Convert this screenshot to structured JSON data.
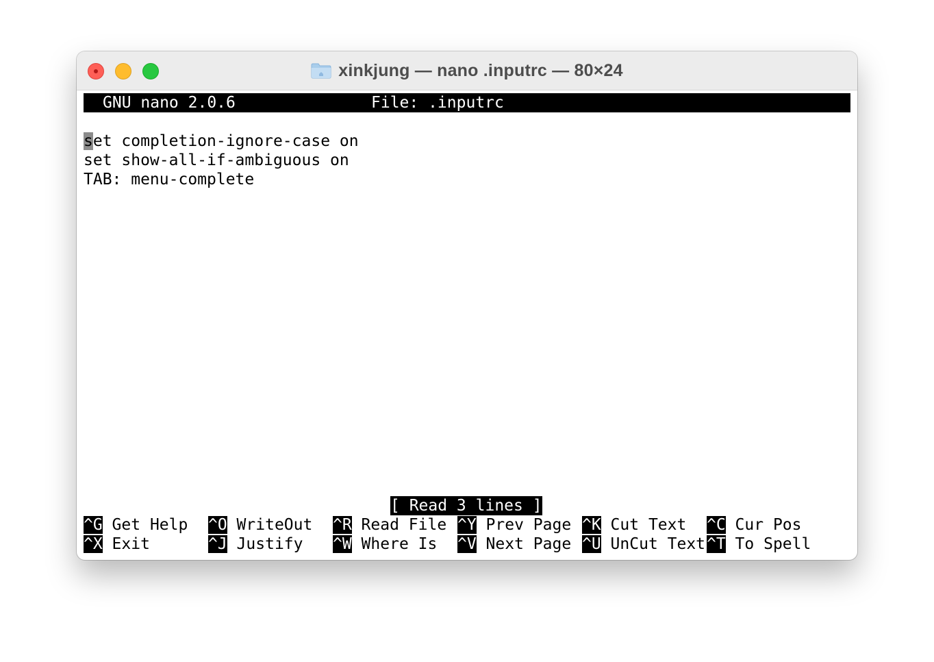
{
  "window": {
    "title": "xinkjung — nano .inputrc — 80×24",
    "icon": "folder-icon"
  },
  "nano": {
    "version_label": "GNU nano 2.0.6",
    "file_label": "File: .inputrc",
    "lines": [
      "set completion-ignore-case on",
      "set show-all-if-ambiguous on",
      "TAB: menu-complete"
    ],
    "cursor_char": "s",
    "first_line_rest": "et completion-ignore-case on",
    "status": "[ Read 3 lines ]"
  },
  "shortcuts": {
    "row1": [
      {
        "key": "^G",
        "label": " Get Help"
      },
      {
        "key": "^O",
        "label": " WriteOut"
      },
      {
        "key": "^R",
        "label": " Read File"
      },
      {
        "key": "^Y",
        "label": " Prev Page"
      },
      {
        "key": "^K",
        "label": " Cut Text"
      },
      {
        "key": "^C",
        "label": " Cur Pos"
      }
    ],
    "row2": [
      {
        "key": "^X",
        "label": " Exit"
      },
      {
        "key": "^J",
        "label": " Justify"
      },
      {
        "key": "^W",
        "label": " Where Is"
      },
      {
        "key": "^V",
        "label": " Next Page"
      },
      {
        "key": "^U",
        "label": " UnCut Text"
      },
      {
        "key": "^T",
        "label": " To Spell"
      }
    ]
  },
  "colors": {
    "close": "#fe5f57",
    "minimize": "#febc2e",
    "maximize": "#28c840",
    "bar": "#000000",
    "cursor": "#8c8c8c"
  }
}
